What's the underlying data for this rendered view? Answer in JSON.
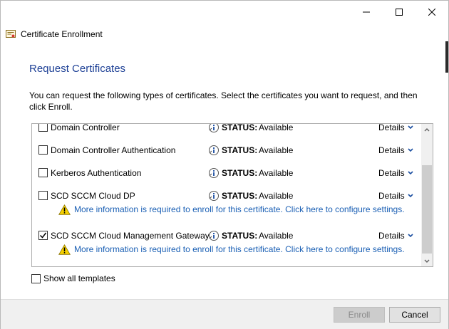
{
  "window": {
    "title": "Certificate Enrollment",
    "controls": [
      "minimize-icon",
      "maximize-icon",
      "close-icon"
    ]
  },
  "page": {
    "heading": "Request Certificates",
    "intro": "You can request the following types of certificates. Select the certificates you want to request, and then click Enroll."
  },
  "certificates": [
    {
      "name": "Domain Controller",
      "checked": false,
      "status_label": "STATUS:",
      "status": "Available",
      "details": "Details"
    },
    {
      "name": "Domain Controller Authentication",
      "checked": false,
      "status_label": "STATUS:",
      "status": "Available",
      "details": "Details"
    },
    {
      "name": "Kerberos Authentication",
      "checked": false,
      "status_label": "STATUS:",
      "status": "Available",
      "details": "Details"
    },
    {
      "name": "SCD SCCM Cloud DP",
      "checked": false,
      "status_label": "STATUS:",
      "status": "Available",
      "details": "Details",
      "warning": "More information is required to enroll for this certificate. Click here to configure settings."
    },
    {
      "name": "SCD SCCM Cloud Management Gateway",
      "checked": true,
      "status_label": "STATUS:",
      "status": "Available",
      "details": "Details",
      "warning": "More information is required to enroll for this certificate. Click here to configure settings."
    }
  ],
  "show_all": {
    "label": "Show all templates",
    "checked": false
  },
  "buttons": {
    "enroll": "Enroll",
    "cancel": "Cancel",
    "enroll_enabled": false
  },
  "colors": {
    "heading": "#1c3f95",
    "link": "#1a5fb4",
    "warning": "#f5d000"
  },
  "scroll": {
    "position_fraction": 0.6
  }
}
